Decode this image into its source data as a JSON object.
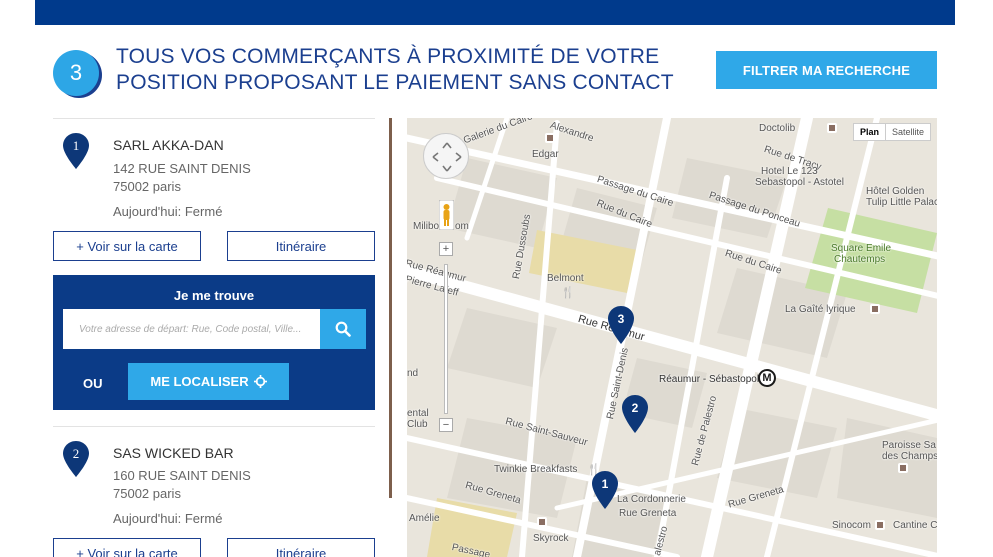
{
  "header": {
    "step_number": "3",
    "title_line1": "TOUS VOS COMMERÇANTS À PROXIMITÉ DE VOTRE",
    "title_line2": "POSITION PROPOSANT LE PAIEMENT SANS CONTACT",
    "filter_button": "FILTRER MA RECHERCHE"
  },
  "stores": [
    {
      "number": "1",
      "name": "SARL AKKA-DAN",
      "address": "142 RUE SAINT DENIS",
      "city": "75002 paris",
      "hours": "Aujourd'hui: Fermé",
      "map_button": "+ Voir sur la carte",
      "route_button": "Itinéraire"
    },
    {
      "number": "2",
      "name": "SAS WICKED BAR",
      "address": "160 RUE SAINT DENIS",
      "city": "75002 paris",
      "hours": "Aujourd'hui: Fermé",
      "map_button": "+ Voir sur la carte",
      "route_button": "Itinéraire"
    }
  ],
  "locator": {
    "title": "Je me trouve",
    "placeholder": "Votre adresse de départ: Rue, Code postal, Ville...",
    "or_label": "OU",
    "locate_button": "ME LOCALISER"
  },
  "map": {
    "toggle_plan": "Plan",
    "toggle_satellite": "Satellite",
    "metro_symbol": "M",
    "markers": [
      "1",
      "2",
      "3"
    ],
    "labels": {
      "galerie": "Galerie du Caire",
      "alexandre": "Alexandre",
      "edgar": "Edgar",
      "doctolib": "Doctolib",
      "rue_de_tracy": "Rue de Tracy",
      "hotel123_1": "Hotel Le 123",
      "hotel123_2": "Sebastopol - Astotel",
      "passage_caire": "Passage du Caire",
      "rue_du_caire": "Rue du Caire",
      "passage_ponceau": "Passage du Ponceau",
      "hotel_golden_1": "Hôtel Golden",
      "hotel_golden_2": "Tulip Little Palac",
      "square_1": "Square Emile",
      "square_2": "Chautemps",
      "milibo": "Milibo",
      "om": "om",
      "rue_dussoubs": "Rue Dussoubs",
      "rue_du_caire2": "Rue du Caire",
      "rue_reaumur_w": "Rue Réaumur",
      "pierre": "Pierre Lafeff",
      "belmont": "Belmont",
      "gaite": "La Gaîté lyrique",
      "rue_reaumur": "Rue Réaumur",
      "reaumur_sebastopol": "Réaumur - Sébastopol",
      "rue_saint_denis": "Rue Saint-Denis",
      "rue_de_palestro": "Rue de Palestro",
      "rue_saint_sauveur": "Rue Saint-Sauveur",
      "ental": "ental",
      "club": "Club",
      "paroisse_1": "Paroisse Sa",
      "paroisse_2": "des Champs",
      "twinkie": "Twinkie Breakfasts",
      "rue_greneta_w": "Rue Greneta",
      "cordonnerie": "La Cordonnerie",
      "rue_greneta": "Rue Greneta",
      "rue_greneta_e": "Rue Greneta",
      "amelie": "Amélie",
      "skyrock": "Skyrock",
      "sinocom": "Sinocom",
      "cantine": "Cantine C",
      "passage": "Passage",
      "palestro_s": "alestro",
      "nd": "nd"
    }
  },
  "colors": {
    "navy": "#0b3b87",
    "title_blue": "#1b3f8f",
    "accent_blue": "#2fa8e8",
    "pin_navy": "#0d3778"
  }
}
